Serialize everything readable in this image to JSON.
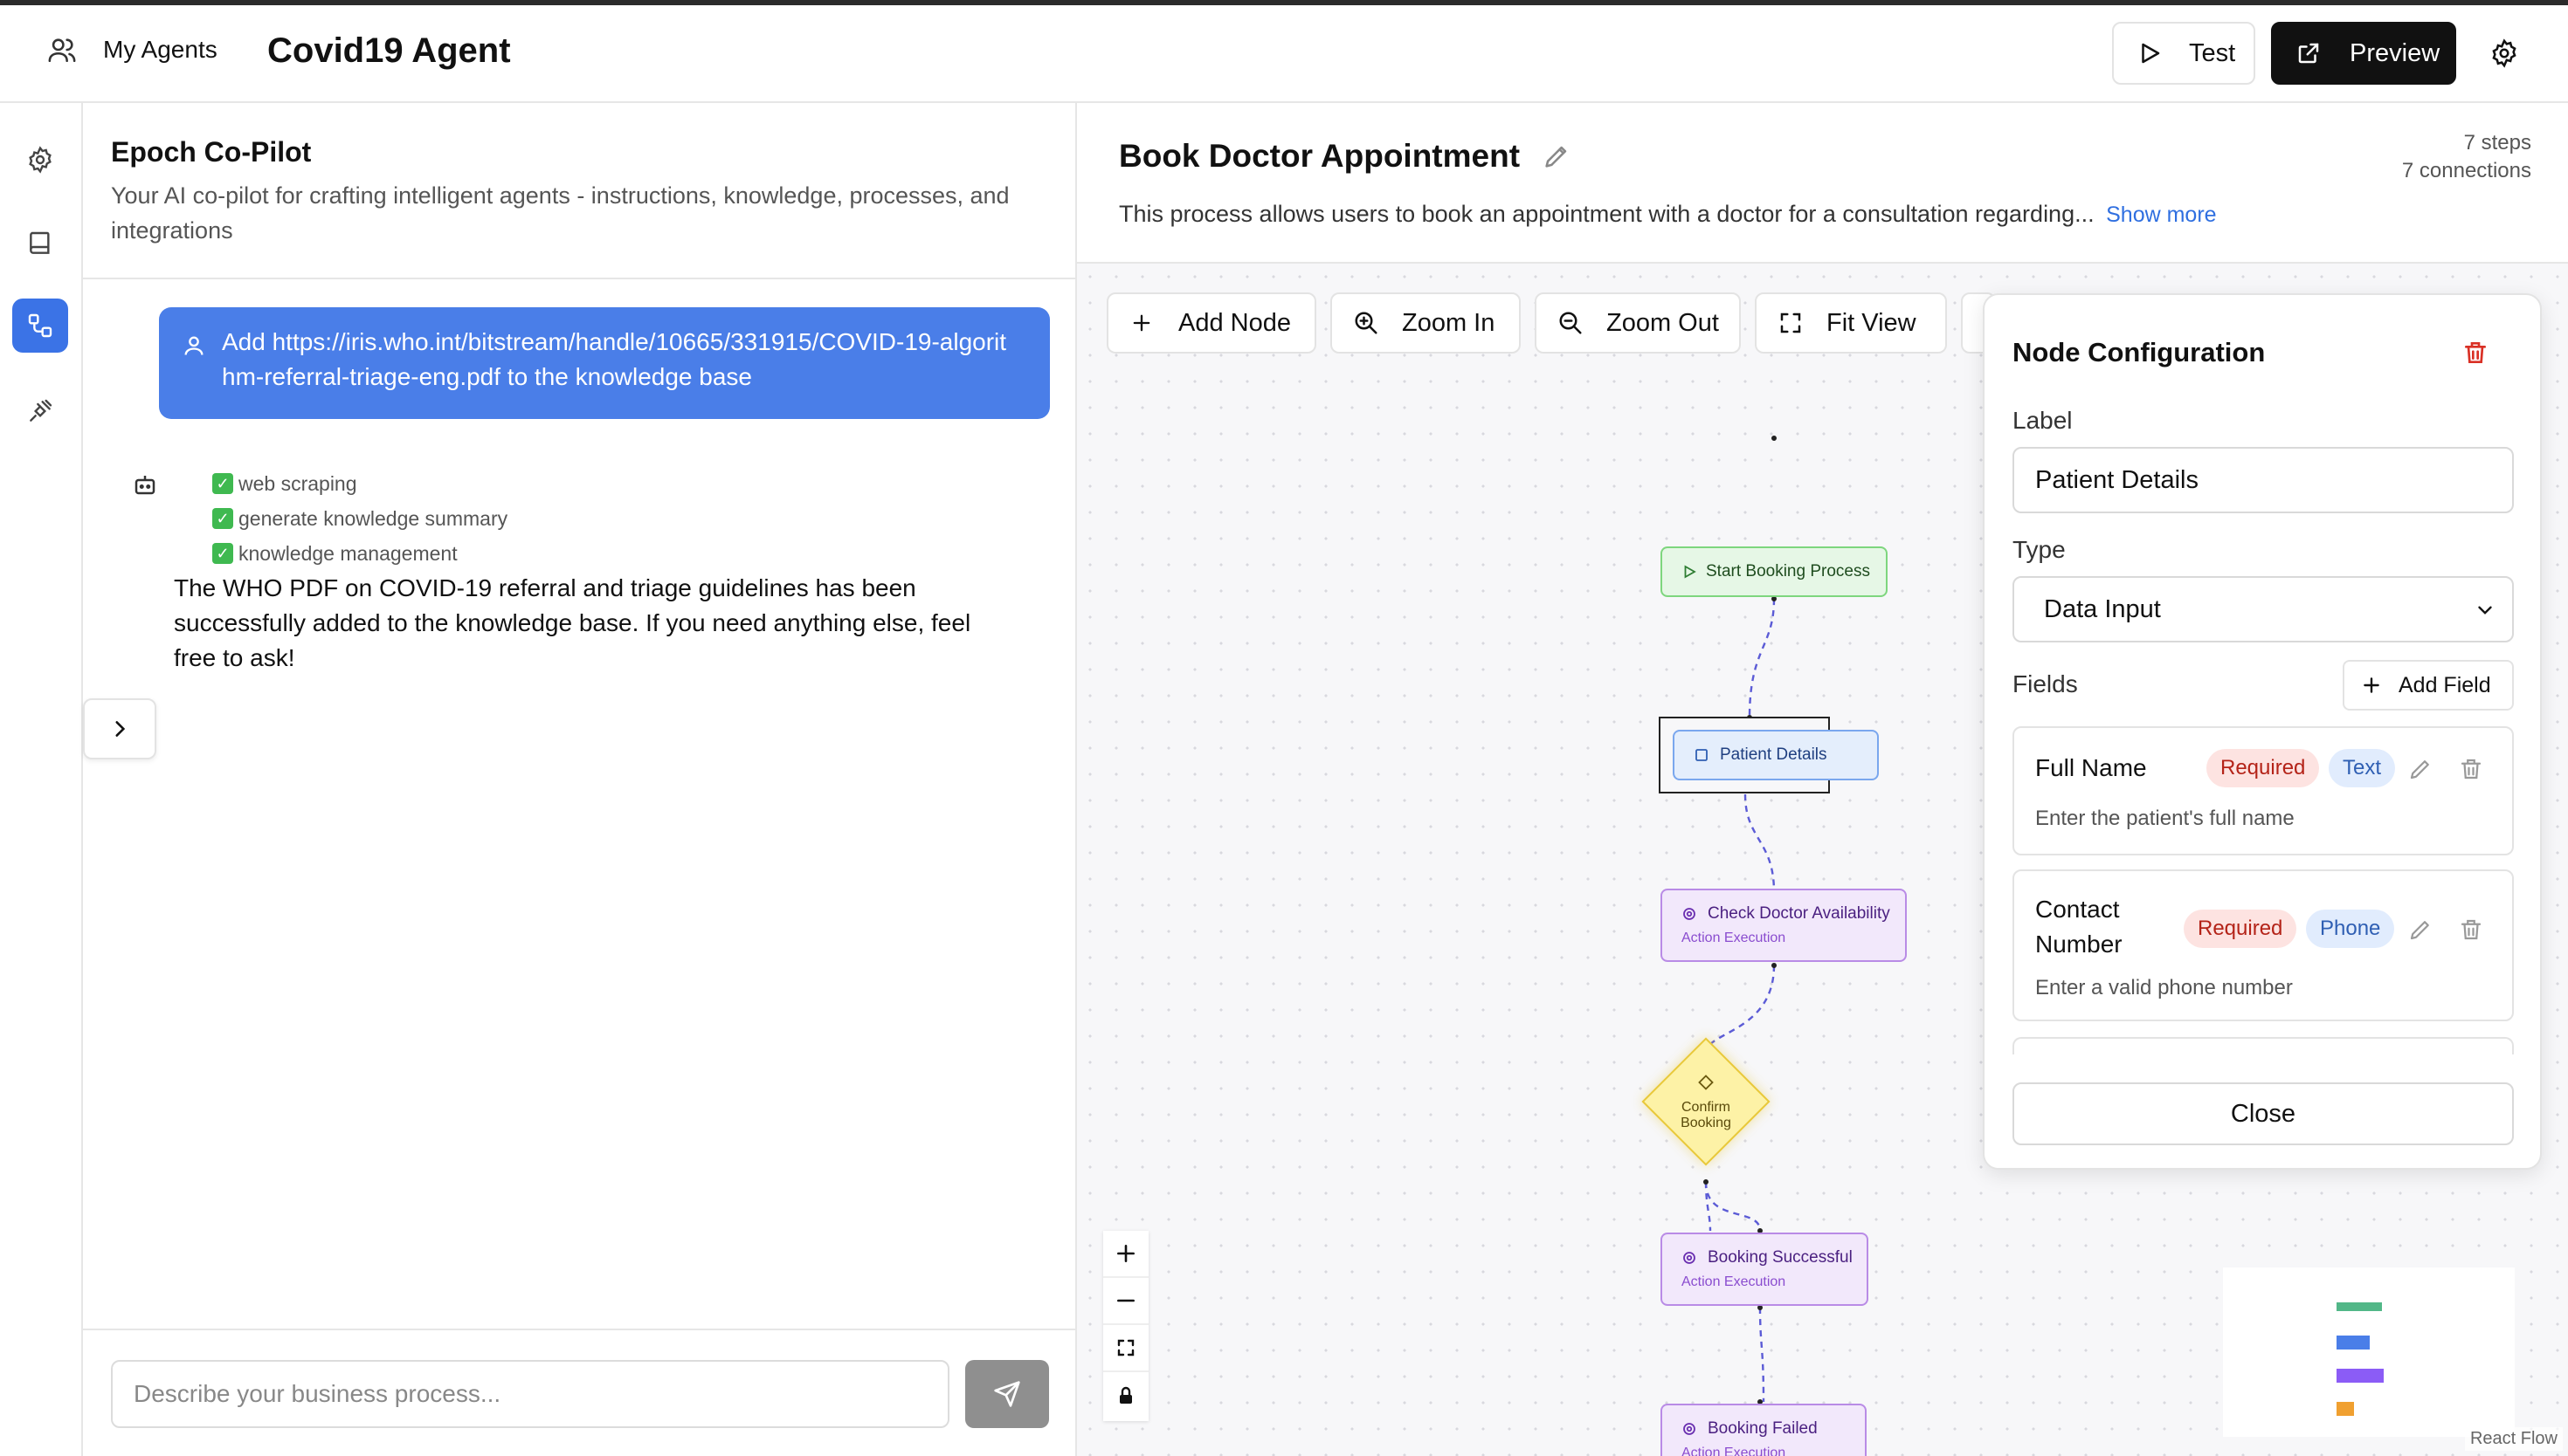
{
  "header": {
    "my_agents": "My Agents",
    "agent_title": "Covid19 Agent",
    "test_label": "Test",
    "preview_label": "Preview"
  },
  "copilot": {
    "title": "Epoch Co-Pilot",
    "subtitle": "Your AI co-pilot for crafting intelligent agents - instructions, knowledge, processes, and integrations",
    "user_message": "Add https://iris.who.int/bitstream/handle/10665/331915/COVID-19-algorithm-referral-triage-eng.pdf to the knowledge base",
    "tool_steps": [
      "web scraping",
      "generate knowledge summary",
      "knowledge management"
    ],
    "bot_reply": "The WHO PDF on COVID-19 referral and triage guidelines has been successfully added to the knowledge base. If you need anything else, feel free to ask!",
    "input_placeholder": "Describe your business process..."
  },
  "process": {
    "title": "Book Doctor Appointment",
    "description": "This process allows users to book an appointment with a doctor for a consultation regarding...",
    "show_more": "Show more",
    "steps": "7 steps",
    "connections": "7 connections"
  },
  "toolbar": {
    "add_node": "Add Node",
    "zoom_in": "Zoom In",
    "zoom_out": "Zoom Out",
    "fit_view": "Fit View"
  },
  "nodes": {
    "start": "Start Booking Process",
    "patient": "Patient Details",
    "check": "Check Doctor Availability",
    "check_sub": "Action Execution",
    "confirm": "Confirm Booking",
    "success": "Booking Successful",
    "success_sub": "Action Execution",
    "failed": "Booking Failed",
    "failed_sub": "Action Execution"
  },
  "config": {
    "title": "Node Configuration",
    "label_label": "Label",
    "label_value": "Patient Details",
    "type_label": "Type",
    "type_value": "Data Input",
    "fields_label": "Fields",
    "add_field": "Add Field",
    "fields": [
      {
        "name": "Full Name",
        "required": "Required",
        "kind": "Text",
        "hint": "Enter the patient's full name"
      },
      {
        "name": "Contact Number",
        "required": "Required",
        "kind": "Phone",
        "hint": "Enter a valid phone number"
      }
    ],
    "close": "Close"
  },
  "attribution": "React Flow",
  "colors": {
    "primary_blue": "#4a7ee8",
    "start_green": "#e6f7e6",
    "action_purple": "#f2e8fb",
    "decision_yellow": "#fdf2a6",
    "delete_red": "#d93025"
  }
}
